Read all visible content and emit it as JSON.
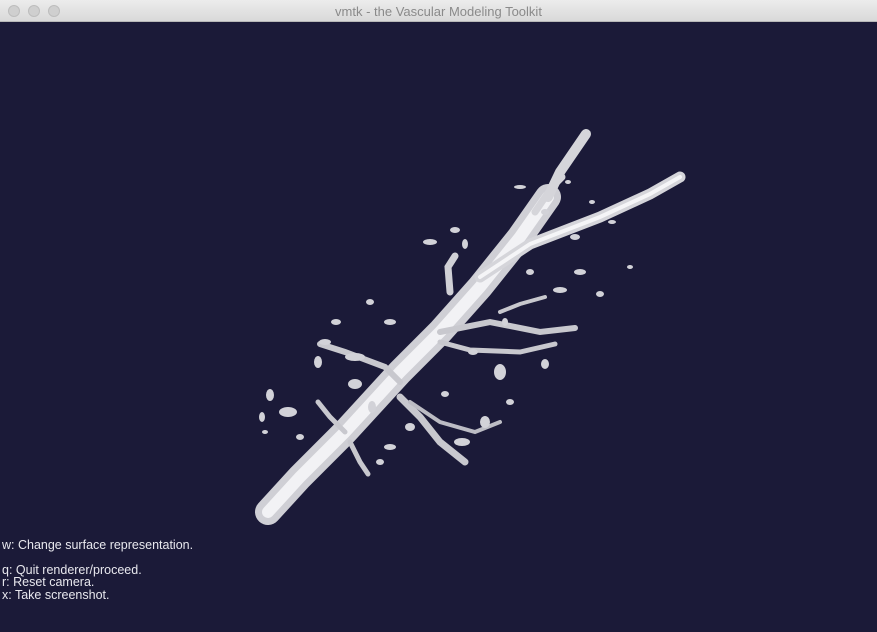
{
  "window": {
    "title": "vmtk - the Vascular Modeling Toolkit",
    "background_color": "#1b1a38"
  },
  "titlebar": {
    "buttons": [
      "close",
      "minimize",
      "zoom"
    ]
  },
  "help_text": {
    "lines": [
      "w: Change surface representation.",
      "q: Quit renderer/proceed.",
      "r: Reset camera.",
      "x: Take screenshot."
    ]
  },
  "scene": {
    "description_color": "#e6e6ea"
  }
}
